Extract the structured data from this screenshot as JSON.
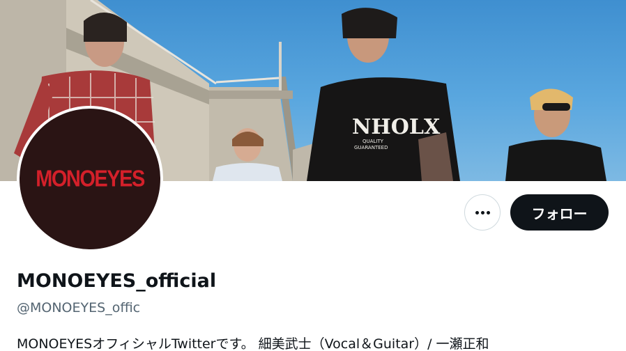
{
  "profile": {
    "avatar_logo_text": "MONOEYES",
    "display_name": "MONOEYES_official",
    "handle": "@MONOEYES_offic",
    "bio": "MONOEYESオフィシャルTwitterです。 細美武士（Vocal＆Guitar）/ 一瀬正和"
  },
  "actions": {
    "more_icon": "more-horizontal-icon",
    "follow_label": "フォロー"
  },
  "colors": {
    "accent_dark": "#0f1419",
    "secondary_text": "#536471",
    "logo_red": "#d4202a",
    "avatar_bg": "#2a1414",
    "sky": "#4b9cd8"
  }
}
